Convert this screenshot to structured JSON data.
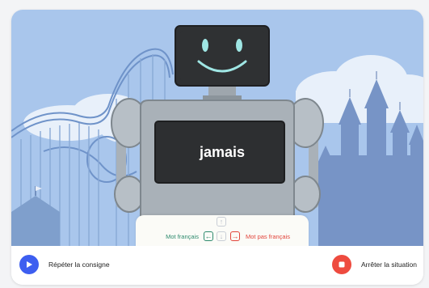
{
  "robot": {
    "word": "jamais"
  },
  "answer_panel": {
    "left_label": "Mot français",
    "right_label": "Mot pas français",
    "keys": {
      "up": "↑",
      "down": "↓",
      "left": "←",
      "right": "→"
    },
    "colors": {
      "left": "#2e8b6e",
      "right": "#e2453c"
    }
  },
  "controls": {
    "repeat_label": "Répéter la consigne",
    "stop_label": "Arrêter la situation",
    "repeat_icon": "play-icon",
    "stop_icon": "stop-icon",
    "colors": {
      "repeat": "#3d5ef0",
      "stop": "#ee4b3f"
    }
  }
}
